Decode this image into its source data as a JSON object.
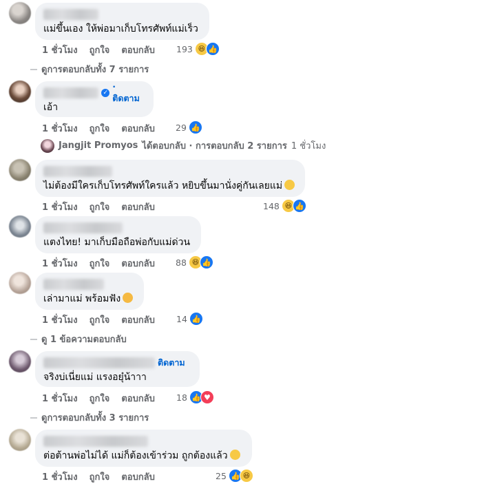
{
  "comments": [
    {
      "text": "แม่ขึ้นเอง ให้พ่อมาเก็บโทรศัพท์แม่เร็ว",
      "time": "1 ชั่วโมง",
      "like": "ถูกใจ",
      "reply": "ตอบกลับ",
      "count": "193"
    },
    {
      "follow": "· ติดตาม",
      "text": "เอ้า",
      "time": "1 ชั่วโมง",
      "like": "ถูกใจ",
      "reply": "ตอบกลับ",
      "count": "29"
    },
    {
      "text": "ไม่ต้องมีใครเก็บโทรศัพท์ใครแล้ว หยิบขึ้นมานั่งคู่กันเลยแม่",
      "time": "1 ชั่วโมง",
      "like": "ถูกใจ",
      "reply": "ตอบกลับ",
      "count": "148"
    },
    {
      "text": "แตงไทย! มาเก็บมือถือพ่อกับแม่ด่วน",
      "time": "1 ชั่วโมง",
      "like": "ถูกใจ",
      "reply": "ตอบกลับ",
      "count": "88"
    },
    {
      "text": "เล่ามาแม่ พร้อมฟัง",
      "time": "1 ชั่วโมง",
      "like": "ถูกใจ",
      "reply": "ตอบกลับ",
      "count": "14"
    },
    {
      "follow": "ติดตาม",
      "text": "จริงบ่เนี่ยแม่ แรงอยุ๋น้าาา",
      "time": "1 ชั่วโมง",
      "like": "ถูกใจ",
      "reply": "ตอบกลับ",
      "count": "18"
    },
    {
      "text": "ต่อต้านพ่อไม่ได้ แม่ก็ต้องเข้าร่วม ถูกต้องแล้ว",
      "time": "1 ชั่วโมง",
      "like": "ถูกใจ",
      "reply": "ตอบกลับ",
      "count": "25"
    }
  ],
  "view_replies_1": "ดูการตอบกลับทั้ง 7 รายการ",
  "reply_summary": {
    "name": "Jangjit Promyos",
    "action": "ได้ตอบกลับ · การตอบกลับ 2 รายการ",
    "time": "1 ชั่วโมง"
  },
  "view_replies_2": "ดู 1 ข้อความตอบกลับ",
  "view_replies_3": "ดูการตอบกลับทั้ง 3 รายการ",
  "icons": {
    "like": "like-icon",
    "haha": "haha-icon",
    "love": "love-icon"
  },
  "colors": {
    "accent": "#1877f2",
    "bubble": "#f0f2f5",
    "muted": "#65676b",
    "follow": "#0064d1"
  }
}
